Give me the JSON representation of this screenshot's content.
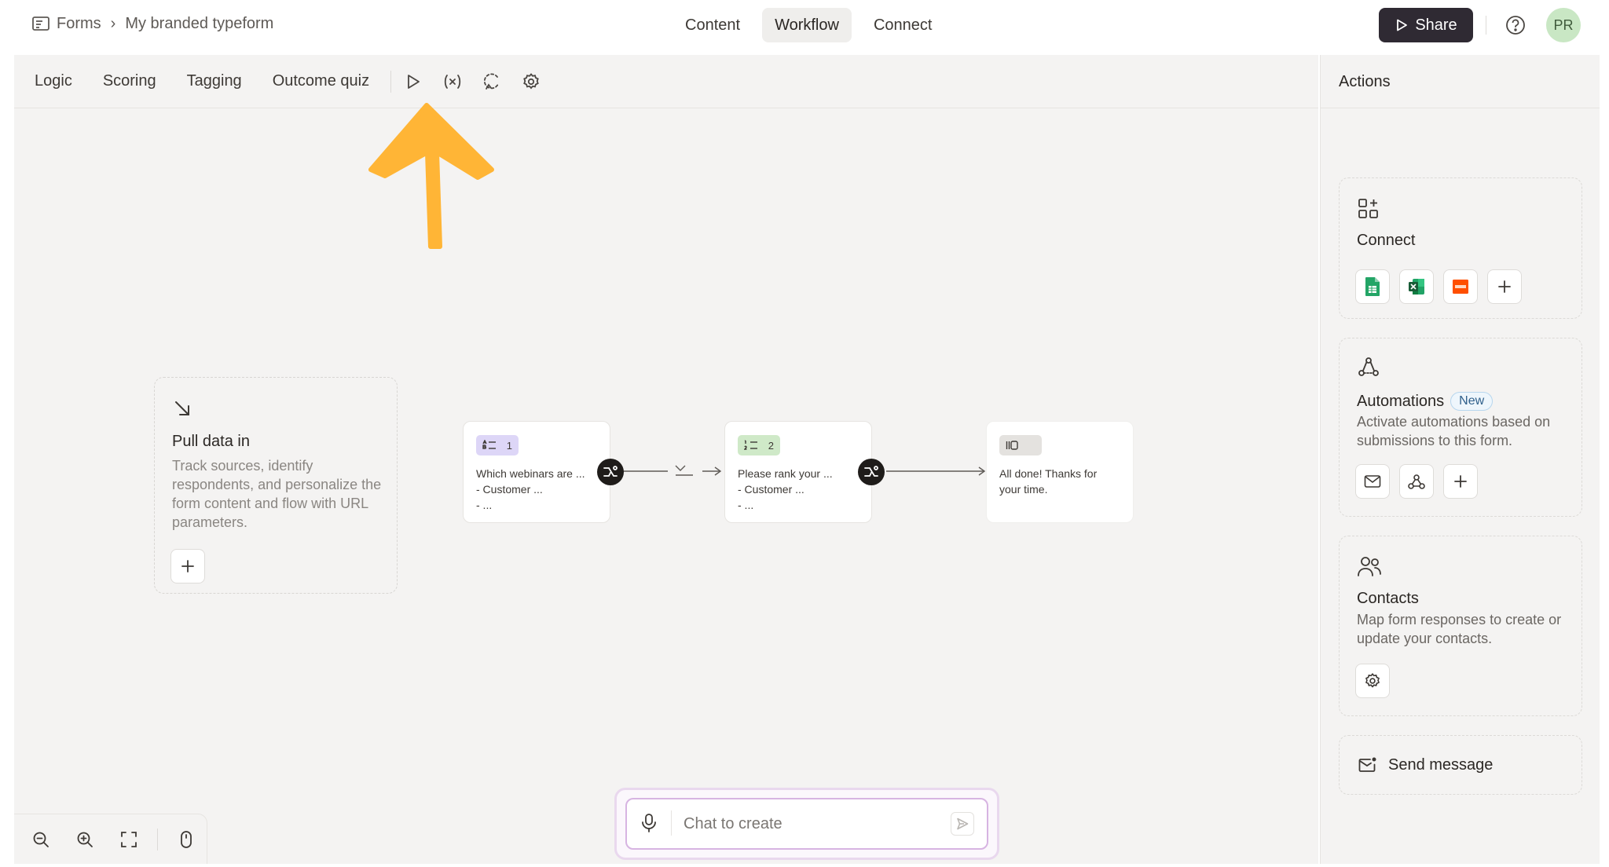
{
  "breadcrumb": {
    "root": "Forms",
    "current": "My branded typeform"
  },
  "top_tabs": [
    {
      "label": "Content",
      "active": false
    },
    {
      "label": "Workflow",
      "active": true
    },
    {
      "label": "Connect",
      "active": false
    }
  ],
  "header": {
    "share_label": "Share",
    "avatar_initials": "PR"
  },
  "sub_tabs": [
    {
      "label": "Logic"
    },
    {
      "label": "Scoring"
    },
    {
      "label": "Tagging"
    },
    {
      "label": "Outcome quiz"
    }
  ],
  "toolbar_icons": [
    "play-icon",
    "variables-icon",
    "loop-icon",
    "settings-icon"
  ],
  "annotation": {
    "arrow_color": "#ffb536",
    "target": "play-icon"
  },
  "pull_data": {
    "title": "Pull data in",
    "description": "Track sources, identify respondents, and personalize the form content and flow with URL parameters."
  },
  "flow": {
    "nodes": [
      {
        "number": "1",
        "badge_color": "#ddd6f7",
        "lines": [
          "Which webinars are ...",
          "- Customer ...",
          "- ..."
        ]
      },
      {
        "number": "2",
        "badge_color": "#cfe9c8",
        "lines": [
          "Please rank your ...",
          "- Customer ...",
          "- ..."
        ]
      },
      {
        "number": "",
        "badge_color": "#e4e2df",
        "lines": [
          "All done! Thanks for",
          "your time."
        ]
      }
    ]
  },
  "chat": {
    "placeholder": "Chat to create"
  },
  "actions": {
    "title": "Actions",
    "connect": {
      "title": "Connect",
      "integrations": [
        "google-sheets-icon",
        "excel-icon",
        "zapier-icon",
        "add-icon"
      ]
    },
    "automations": {
      "title": "Automations",
      "badge": "New",
      "description": "Activate automations based on submissions to this form."
    },
    "contacts": {
      "title": "Contacts",
      "description": "Map form responses to create or update your contacts."
    },
    "send_message": {
      "label": "Send message"
    }
  },
  "zoom_controls": [
    "zoom-out-icon",
    "zoom-in-icon",
    "fit-screen-icon",
    "mouse-icon"
  ]
}
